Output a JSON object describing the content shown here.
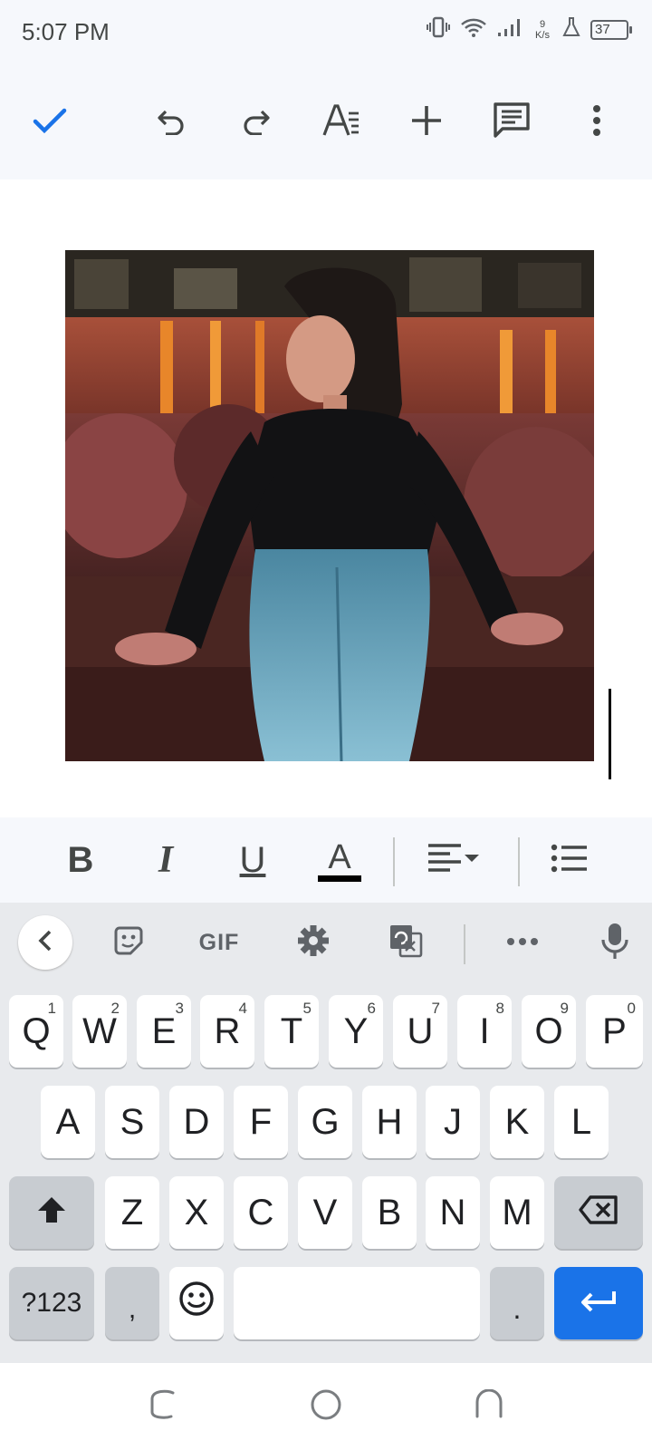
{
  "status_bar": {
    "time": "5:07 PM",
    "net_speed_value": "9",
    "net_speed_unit": "K/s",
    "battery": "37"
  },
  "toolbar": {
    "icons": [
      "check-icon",
      "undo-icon",
      "redo-icon",
      "text-format-icon",
      "add-icon",
      "comment-icon",
      "more-vert-icon"
    ]
  },
  "format_bar": {
    "bold": "B",
    "italic": "I",
    "underline": "U",
    "text_color": "A",
    "text_color_value": "#000000"
  },
  "keyboard_toolbar": {
    "gif": "GIF"
  },
  "keyboard": {
    "row1": [
      {
        "key": "Q",
        "hint": "1"
      },
      {
        "key": "W",
        "hint": "2"
      },
      {
        "key": "E",
        "hint": "3"
      },
      {
        "key": "R",
        "hint": "4"
      },
      {
        "key": "T",
        "hint": "5"
      },
      {
        "key": "Y",
        "hint": "6"
      },
      {
        "key": "U",
        "hint": "7"
      },
      {
        "key": "I",
        "hint": "8"
      },
      {
        "key": "O",
        "hint": "9"
      },
      {
        "key": "P",
        "hint": "0"
      }
    ],
    "row2": [
      "A",
      "S",
      "D",
      "F",
      "G",
      "H",
      "J",
      "K",
      "L"
    ],
    "row3": [
      "Z",
      "X",
      "C",
      "V",
      "B",
      "N",
      "M"
    ],
    "symbols_key": "?123",
    "comma_key": ",",
    "period_key": "."
  },
  "colors": {
    "accent": "#1a73e8",
    "chrome_bg": "#f6f8fc",
    "keyboard_bg": "#e8eaed"
  }
}
